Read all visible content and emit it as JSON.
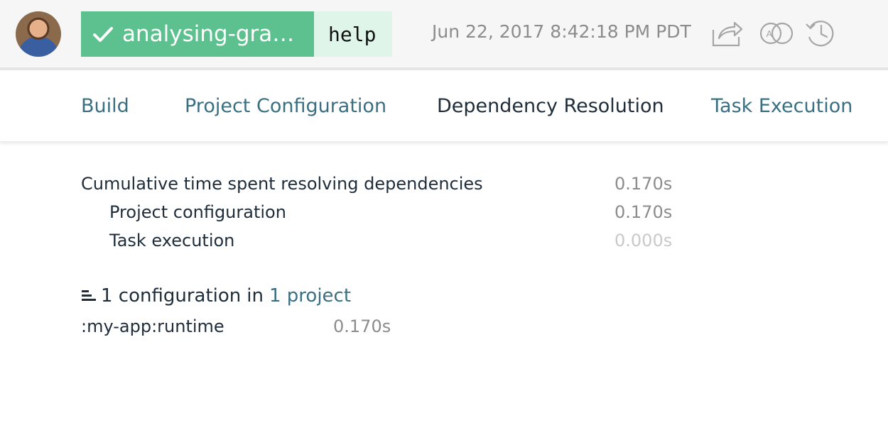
{
  "header": {
    "build_name": "analysing-gradle…",
    "task": "help",
    "timestamp": "Jun 22, 2017 8:42:18 PM PDT",
    "status_color": "#5cc18e",
    "icons": [
      "share-icon",
      "compare-icon",
      "history-icon"
    ]
  },
  "tabs": [
    {
      "label": "Build",
      "active": false
    },
    {
      "label": "Project Configuration",
      "active": false
    },
    {
      "label": "Dependency Resolution",
      "active": true
    },
    {
      "label": "Task Execution",
      "active": false
    }
  ],
  "summary": {
    "cumulative_label": "Cumulative time spent resolving dependencies",
    "cumulative_value": "0.170s",
    "project_config_label": "Project configuration",
    "project_config_value": "0.170s",
    "task_exec_label": "Task execution",
    "task_exec_value": "0.000s"
  },
  "configurations": {
    "count_text": "1 configuration",
    "in_text": "in",
    "project_link": "1 project",
    "items": [
      {
        "name": ":my-app:runtime",
        "time": "0.170s"
      }
    ]
  }
}
